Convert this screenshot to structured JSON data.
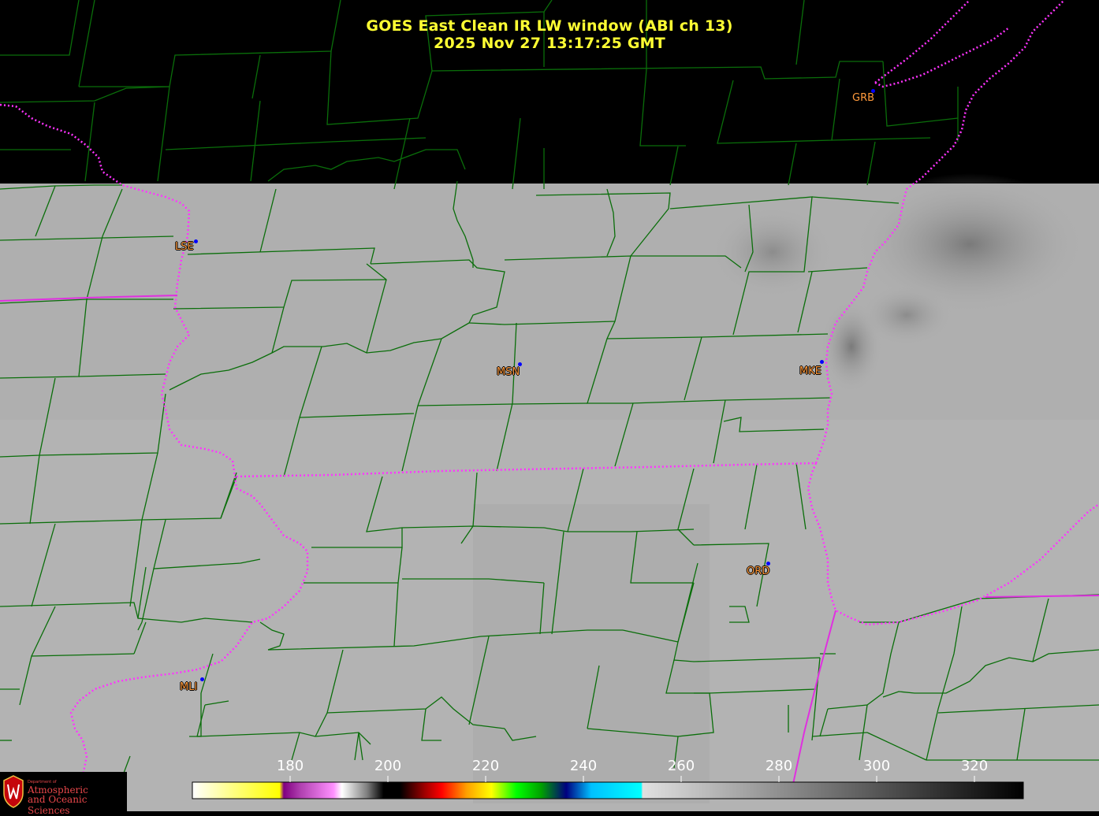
{
  "title": {
    "line1": "GOES East Clean IR LW window (ABI ch 13)",
    "line2": "2025 Nov 27  13:17:25 GMT"
  },
  "stations": [
    {
      "id": "LSE",
      "label": "LSE"
    },
    {
      "id": "MSN",
      "label": "MSN"
    },
    {
      "id": "MKE",
      "label": "MKE"
    },
    {
      "id": "GRB",
      "label": "GRB"
    },
    {
      "id": "ORD",
      "label": "ORD"
    },
    {
      "id": "MLI",
      "label": "MLI"
    }
  ],
  "colorbar": {
    "min": 160,
    "max": 330,
    "ticks": [
      "180",
      "200",
      "220",
      "240",
      "260",
      "280",
      "300",
      "320"
    ],
    "tick_values": [
      180,
      200,
      220,
      240,
      260,
      280,
      300,
      320
    ]
  },
  "logo": {
    "dept": "Department of",
    "line1": "Atmospheric",
    "line2": "and Oceanic Sciences"
  },
  "colors": {
    "title": "#ffff33",
    "county_lines": "#0a6e0a",
    "state_borders": "#ff33ff",
    "station_label": "#ff9a3c",
    "station_dot": "#0000ff",
    "no_data": "#000000",
    "cloud_gray": "#b4b4b4"
  }
}
